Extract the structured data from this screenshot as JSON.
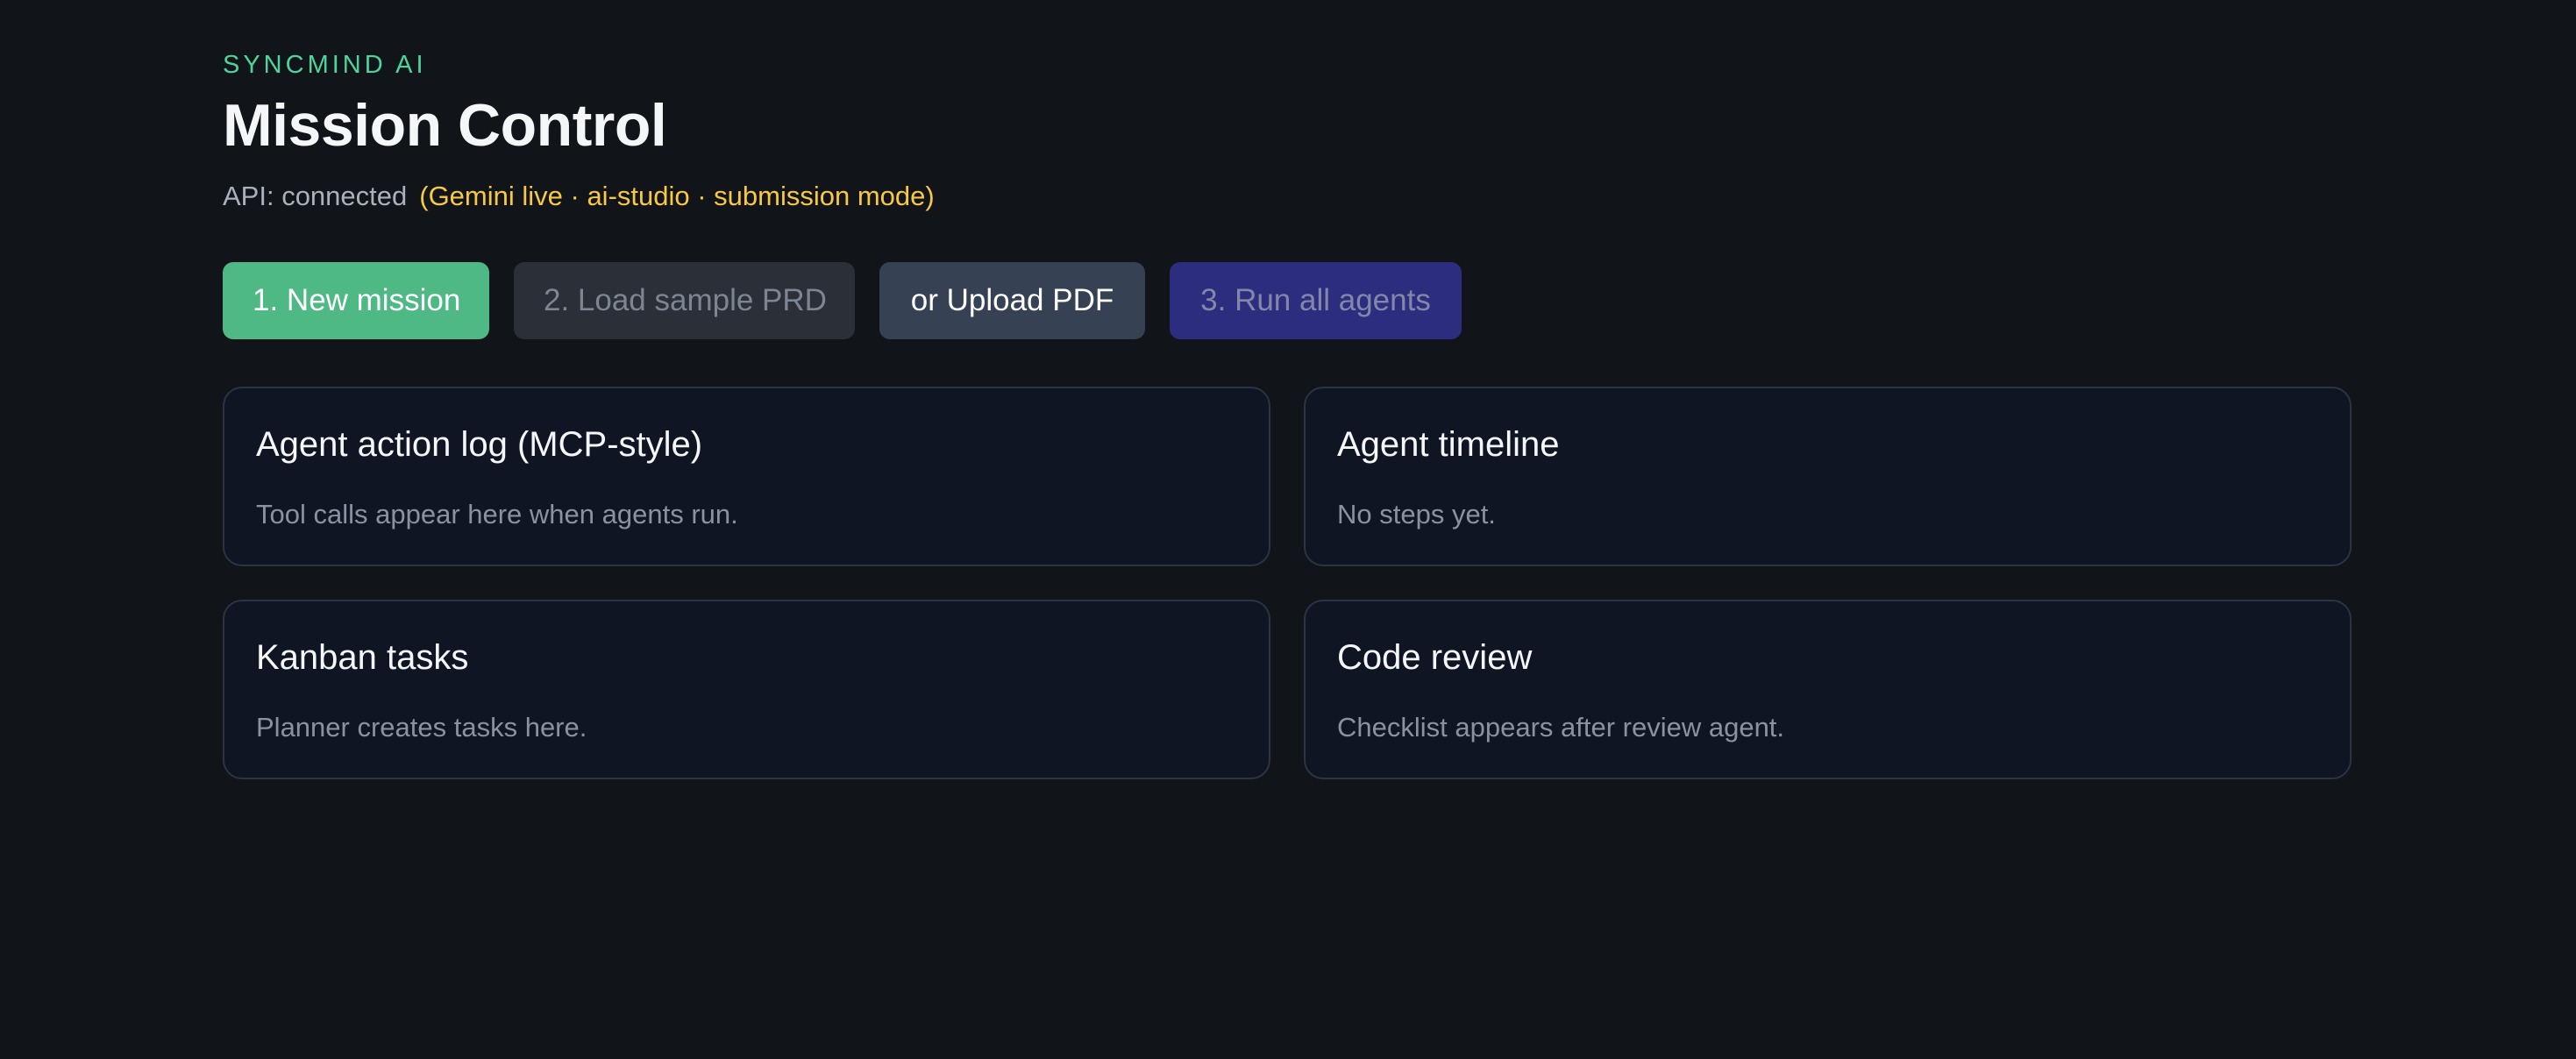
{
  "header": {
    "brand": "SYNCMIND AI",
    "title": "Mission Control",
    "api_status": "API: connected",
    "mode_info": "(Gemini live · ai-studio · submission mode)"
  },
  "actions": {
    "new_mission": "1. New mission",
    "load_sample": "2. Load sample PRD",
    "upload_pdf": "or Upload PDF",
    "run_agents": "3. Run all agents"
  },
  "panels": {
    "action_log": {
      "title": "Agent action log (MCP-style)",
      "empty": "Tool calls appear here when agents run."
    },
    "timeline": {
      "title": "Agent timeline",
      "empty": "No steps yet."
    },
    "kanban": {
      "title": "Kanban tasks",
      "empty": "Planner creates tasks here."
    },
    "code_review": {
      "title": "Code review",
      "empty": "Checklist appears after review agent."
    }
  },
  "colors": {
    "background": "#111418",
    "brand": "#4ed39a",
    "mode_highlight": "#f6c845",
    "primary_button": "#4fb985",
    "run_button": "#2d2d80"
  }
}
